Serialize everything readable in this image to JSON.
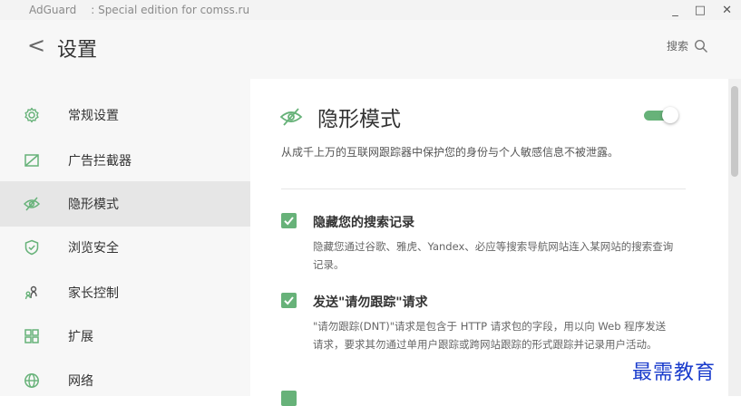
{
  "window": {
    "app_name": "AdGuard",
    "edition": ": Special edition for comss.ru",
    "minimize": "_",
    "maximize": "□",
    "close": "✕"
  },
  "header": {
    "back_symbol": "<",
    "title": "设置",
    "search_label": "搜索"
  },
  "sidebar": {
    "items": [
      {
        "label": "常规设置",
        "icon": "gear-icon"
      },
      {
        "label": "广告拦截器",
        "icon": "ad-block-icon"
      },
      {
        "label": "隐形模式",
        "icon": "stealth-eye-icon",
        "active": true
      },
      {
        "label": "浏览安全",
        "icon": "shield-icon"
      },
      {
        "label": "家长控制",
        "icon": "parental-icon"
      },
      {
        "label": "扩展",
        "icon": "extensions-icon"
      },
      {
        "label": "网络",
        "icon": "globe-icon"
      }
    ]
  },
  "main": {
    "title": "隐形模式",
    "enabled": true,
    "description": "从成千上万的互联网跟踪器中保护您的身份与个人敏感信息不被泄露。",
    "options": [
      {
        "title": "隐藏您的搜索记录",
        "checked": true,
        "description": "隐藏您通过谷歌、雅虎、Yandex、必应等搜索导航网站连入某网站的搜索查询记录。"
      },
      {
        "title": "发送\"请勿跟踪\"请求",
        "checked": true,
        "description": "\"请勿跟踪(DNT)\"请求是包含于 HTTP 请求包的字段，用以向 Web 程序发送请求，要求其勿通过单用户跟踪或跨网站跟踪的形式跟踪并记录用户活动。"
      }
    ]
  },
  "colors": {
    "accent": "#67b279",
    "sidebar_bg": "#f7f7f7",
    "active_bg": "#e6e6e6",
    "watermark": "#1a3ccc"
  },
  "watermark": "最需教育"
}
